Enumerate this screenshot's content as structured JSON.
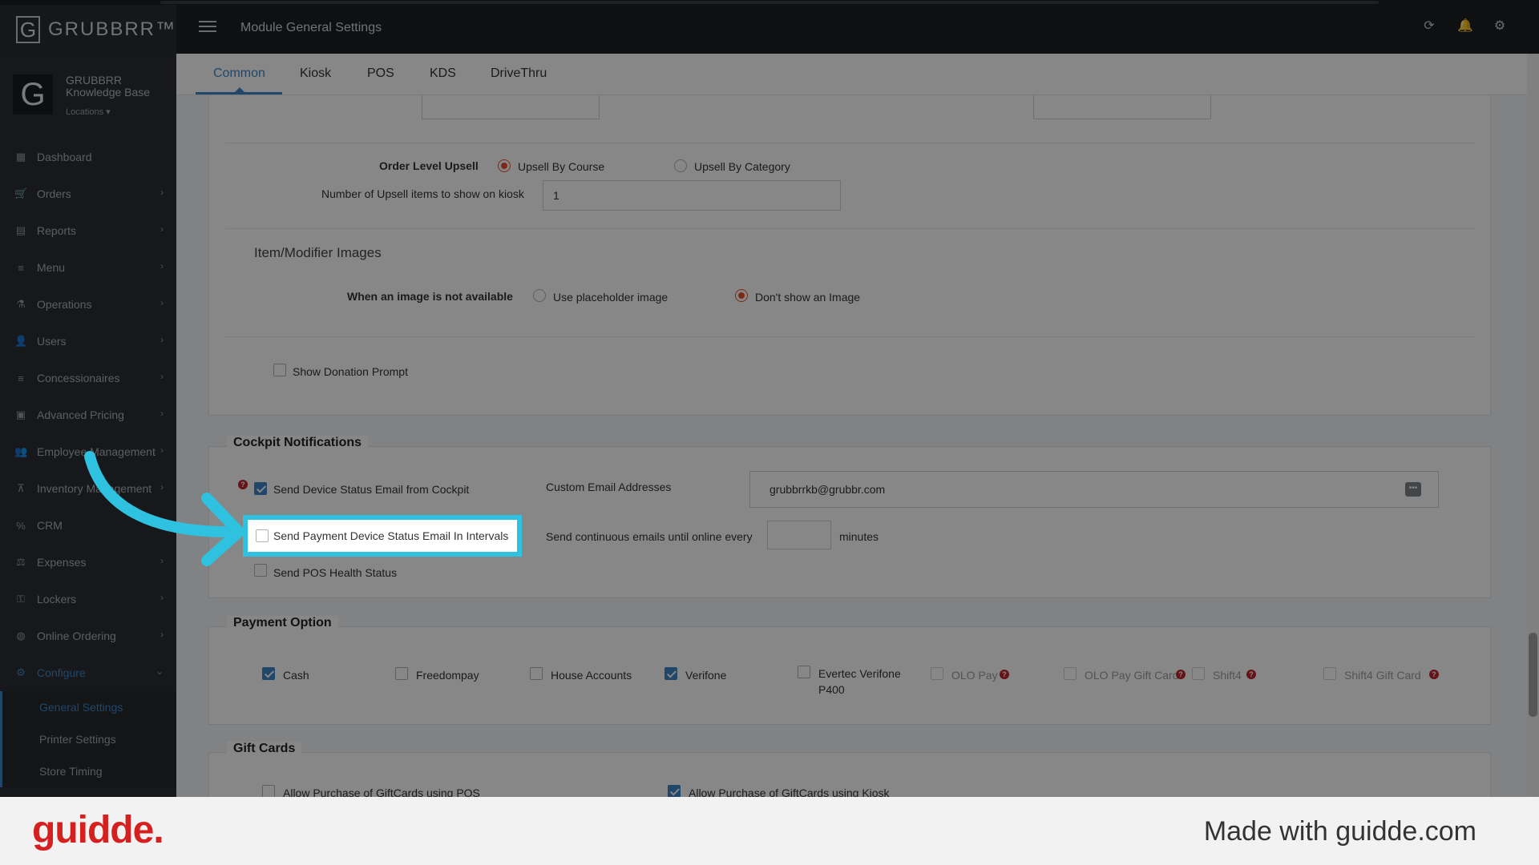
{
  "header": {
    "logo_text": "GRUBBRR™",
    "logo_mark": "G",
    "page_title": "Module General Settings",
    "icons": [
      "refresh-icon",
      "bell-icon",
      "gear-icon"
    ]
  },
  "sidebar": {
    "brand_mark": "G",
    "brand_line1": "GRUBBRR",
    "brand_line2": "Knowledge Base",
    "locations_label": "Locations ▾",
    "items": [
      {
        "label": "Dashboard",
        "icon": "dashboard-icon",
        "glyph": "▦",
        "chevron": false
      },
      {
        "label": "Orders",
        "icon": "cart-icon",
        "glyph": "🛒",
        "chevron": true
      },
      {
        "label": "Reports",
        "icon": "report-icon",
        "glyph": "▤",
        "chevron": true
      },
      {
        "label": "Menu",
        "icon": "menu-list-icon",
        "glyph": "≡",
        "chevron": true
      },
      {
        "label": "Operations",
        "icon": "flask-icon",
        "glyph": "⚗",
        "chevron": true
      },
      {
        "label": "Users",
        "icon": "user-add-icon",
        "glyph": "👤",
        "chevron": true
      },
      {
        "label": "Concessionaires",
        "icon": "list-icon",
        "glyph": "≡",
        "chevron": true
      },
      {
        "label": "Advanced Pricing",
        "icon": "money-icon",
        "glyph": "▣",
        "chevron": true
      },
      {
        "label": "Employee Management",
        "icon": "users-icon",
        "glyph": "👥",
        "chevron": true
      },
      {
        "label": "Inventory Management",
        "icon": "sitemap-icon",
        "glyph": "⊼",
        "chevron": true
      },
      {
        "label": "CRM",
        "icon": "percent-icon",
        "glyph": "%",
        "chevron": false
      },
      {
        "label": "Expenses",
        "icon": "scale-icon",
        "glyph": "⚖",
        "chevron": true
      },
      {
        "label": "Lockers",
        "icon": "lockers-icon",
        "glyph": "⚿",
        "chevron": true
      },
      {
        "label": "Online Ordering",
        "icon": "globe-icon",
        "glyph": "◍",
        "chevron": true
      },
      {
        "label": "Configure",
        "icon": "cog-icon",
        "glyph": "⚙",
        "chevron": true
      }
    ],
    "subitems": [
      "General Settings",
      "Printer Settings",
      "Store Timing"
    ]
  },
  "tabs": [
    "Common",
    "Kiosk",
    "POS",
    "KDS",
    "DriveThru"
  ],
  "upsell": {
    "label": "Order Level Upsell",
    "opt_course": "Upsell By Course",
    "opt_category": "Upsell By Category",
    "count_label": "Number of Upsell items to show on kiosk",
    "count_value": "1"
  },
  "images": {
    "section_title": "Item/Modifier Images",
    "label": "When an image is not available",
    "opt_placeholder": "Use placeholder image",
    "opt_none": "Don't show an Image",
    "donation": "Show Donation Prompt"
  },
  "cockpit": {
    "title": "Cockpit Notifications",
    "send_device_status": "Send Device Status Email from Cockpit",
    "custom_email_label": "Custom Email Addresses",
    "custom_email_value": "grubbrrkb@grubbr.com",
    "send_payment_status": "Send Payment Device Status Email In Intervals",
    "continuous_label": "Send continuous emails until online every",
    "minutes_label": "minutes",
    "pos_health": "Send POS Health Status"
  },
  "payment": {
    "title": "Payment Option",
    "options": [
      {
        "label": "Cash",
        "checked": true
      },
      {
        "label": "Freedompay",
        "checked": false
      },
      {
        "label": "House Accounts",
        "checked": false
      },
      {
        "label": "Verifone",
        "checked": true
      },
      {
        "label": "Evertec Verifone",
        "label2": "P400",
        "checked": false
      },
      {
        "label": "OLO Pay",
        "checked": false
      },
      {
        "label": "OLO Pay Gift Card",
        "checked": false
      },
      {
        "label": "Shift4",
        "checked": false
      },
      {
        "label": "Shift4 Gift Card",
        "checked": false
      }
    ]
  },
  "giftcards": {
    "title": "Gift Cards",
    "pos_label": "Allow Purchase of GiftCards using POS",
    "kiosk_label": "Allow Purchase of GiftCards using Kiosk"
  },
  "footer": {
    "logo": "guidde.",
    "made_with": "Made with guidde.com"
  },
  "colors": {
    "accent": "#3d86c6",
    "radio_on": "#e9502b",
    "highlight": "#2fc1e0",
    "guidde_red": "#d61f1f"
  }
}
